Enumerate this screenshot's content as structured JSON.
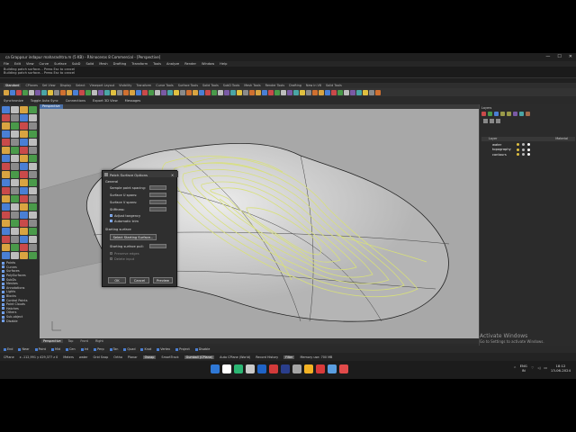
{
  "window": {
    "title": "ca Grappsur indapur maharashtra.m (5 KB) - Rhinoceros 8 Commercial - [Perspective]",
    "controls": [
      "—",
      "☐",
      "✕"
    ]
  },
  "menu": [
    "File",
    "Edit",
    "View",
    "Curve",
    "Surface",
    "SubD",
    "Solid",
    "Mesh",
    "Drafting",
    "Transform",
    "Tools",
    "Analyze",
    "Render",
    "Window",
    "Help"
  ],
  "command_history": [
    "Building patch surface... Press Esc to cancel",
    "Building patch surface... Press Esc to cancel"
  ],
  "toolbar_tabs": [
    "Standard",
    "CPlanes",
    "Set View",
    "Display",
    "Select",
    "Viewport Layout",
    "Visibility",
    "Transform",
    "Curve Tools",
    "Surface Tools",
    "Solid Tools",
    "SubD Tools",
    "Mesh Tools",
    "Render Tools",
    "Drafting",
    "New in V8",
    "Solid Tools"
  ],
  "mid_toolbar": [
    "Synchronize",
    "Toggle Auto Sync",
    "Connections",
    "Export 3D View",
    "Messages"
  ],
  "viewport": {
    "active_tab": "Perspective",
    "bottom_tabs": [
      "Perspective",
      "Top",
      "Front",
      "Right"
    ]
  },
  "filters": [
    "Points",
    "Curves",
    "Surfaces",
    "PolySurfaces",
    "SubDs",
    "Meshes",
    "Annotations",
    "Lights",
    "Blocks",
    "Control Points",
    "Point Clouds",
    "Hatches",
    "Others",
    "Sub-object",
    "Disable"
  ],
  "dialog": {
    "title": "Patch Surface Options",
    "section_general": "General",
    "sample_point_spacing": "Sample point spacing:",
    "u_spans": "Surface U spans:",
    "v_spans": "Surface V spans:",
    "stiffness": "Stiffness:",
    "adjust_tangency": "Adjust tangency",
    "automatic_trim": "Automatic trim",
    "section_starting": "Starting surface",
    "select_starting": "Select Starting Surface...",
    "starting_pull": "Starting surface pull:",
    "preserve_edges": "Preserve edges",
    "delete_input": "Delete input",
    "ok": "OK",
    "cancel": "Cancel",
    "preview": "Preview"
  },
  "layers_panel": {
    "title": "Layers",
    "header_layer": "Layer",
    "header_material": "Material",
    "layers": [
      {
        "name": "water",
        "color": "#ffffff"
      },
      {
        "name": "topography",
        "color": "#ffffff"
      },
      {
        "name": "contours",
        "color": "#ffffff"
      }
    ]
  },
  "osnaps": [
    "End",
    "Near",
    "Point",
    "Mid",
    "Cen",
    "Int",
    "Perp",
    "Tan",
    "Quad",
    "Knot",
    "Vertex",
    "Project",
    "Disable"
  ],
  "status_bar": [
    "CPlane",
    "x -112,991  y 429,377  z 0",
    "Meters",
    "water",
    "Grid Snap",
    "Ortho",
    "Planar",
    "Osnap",
    "SmartTrack",
    "Gumball (CPlane)",
    "Auto CPlane (World)",
    "Record History",
    "Filter",
    "Memory use: 700 MB"
  ],
  "watermark": {
    "line1": "Activate Windows",
    "line2": "Go to Settings to activate Windows."
  },
  "tray": {
    "lang1": "ENG",
    "lang2": "IN",
    "time": "18:12",
    "date": "13-06-2024"
  },
  "colors": {
    "contour": "#d8e07a",
    "terrain": "#c2c2c2",
    "viewport_bg": "#a8a8a8"
  }
}
